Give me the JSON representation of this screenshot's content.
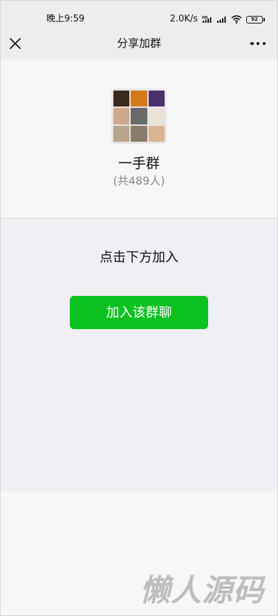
{
  "status_bar": {
    "time": "晚上9:59",
    "net_speed": "2.0K/s",
    "battery": "92"
  },
  "nav": {
    "title": "分享加群",
    "close_icon": "close-icon",
    "more_icon": "more-icon"
  },
  "group": {
    "name": "一手群",
    "member_count": "(共489人)",
    "avatar_colors": [
      "#3a2a1c",
      "#d27a1a",
      "#4a2f6b",
      "#cfa88a",
      "#6a6a6a",
      "#e8e2d8",
      "#b9a48e",
      "#8b7b6a",
      "#d9b48f"
    ]
  },
  "join": {
    "hint": "点击下方加入",
    "button_label": "加入该群聊",
    "button_color": "#0bc11f"
  },
  "watermark": "懒人源码"
}
